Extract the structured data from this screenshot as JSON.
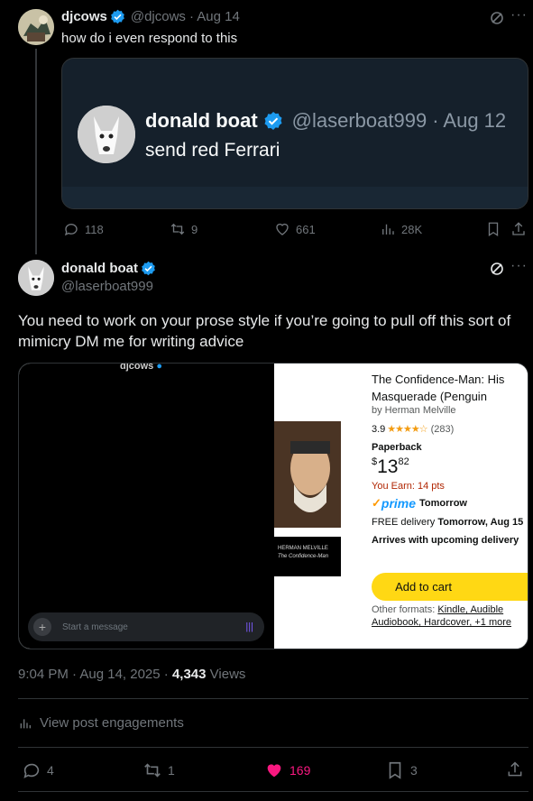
{
  "tweet1": {
    "name": "djcows",
    "handle": "@djcows",
    "date": "· Aug 14",
    "text": "how do i even respond to this",
    "quoted": {
      "name": "donald boat",
      "handle": "@laserboat999",
      "date": "· Aug 12",
      "text": "send red Ferrari"
    },
    "stats": {
      "replies": "118",
      "reposts": "9",
      "likes": "661",
      "views": "28K"
    }
  },
  "tweet2": {
    "name": "donald boat",
    "handle": "@laserboat999",
    "text": "You need to work on your prose style if you’re going to pull off this sort of mimicry DM me for writing advice",
    "media": {
      "chat_header": "djcows",
      "message_placeholder": "Start a message",
      "product": {
        "title": "The Confidence-Man: His Masquerade (Penguin Classics)",
        "author": "by Herman Melville",
        "rating": "3.9",
        "stars": 3.9,
        "reviews": "(283)",
        "format": "Paperback",
        "price_symbol": "$",
        "price_whole": "13",
        "price_fraction": "82",
        "earn": "You Earn: 14 pts",
        "prime": "prime",
        "prime_tomorrow": "Tomorrow",
        "free_delivery": "FREE delivery",
        "delivery_day": "Tomorrow, Aug 15",
        "upcoming": "Arrives with upcoming delivery",
        "add_to_cart": "Add to cart",
        "other_formats_label": "Other formats:",
        "other_formats": "Kindle, Audible Audiobook, Hardcover, +1 more",
        "cover_author": "HERMAN MELVILLE",
        "cover_title": "The Confidence-Man"
      }
    },
    "timestamp": "9:04 PM · Aug 14, 2025 ·",
    "views_count": "4,343",
    "views_label": "Views",
    "engagements": "View post engagements",
    "stats": {
      "replies": "4",
      "reposts": "1",
      "likes": "169",
      "bookmarks": "3"
    }
  },
  "colors": {
    "verified": "#1d9bf0",
    "like": "#f91880",
    "prime": "#1399ff",
    "earn": "#b12704",
    "cart": "#ffd814"
  }
}
